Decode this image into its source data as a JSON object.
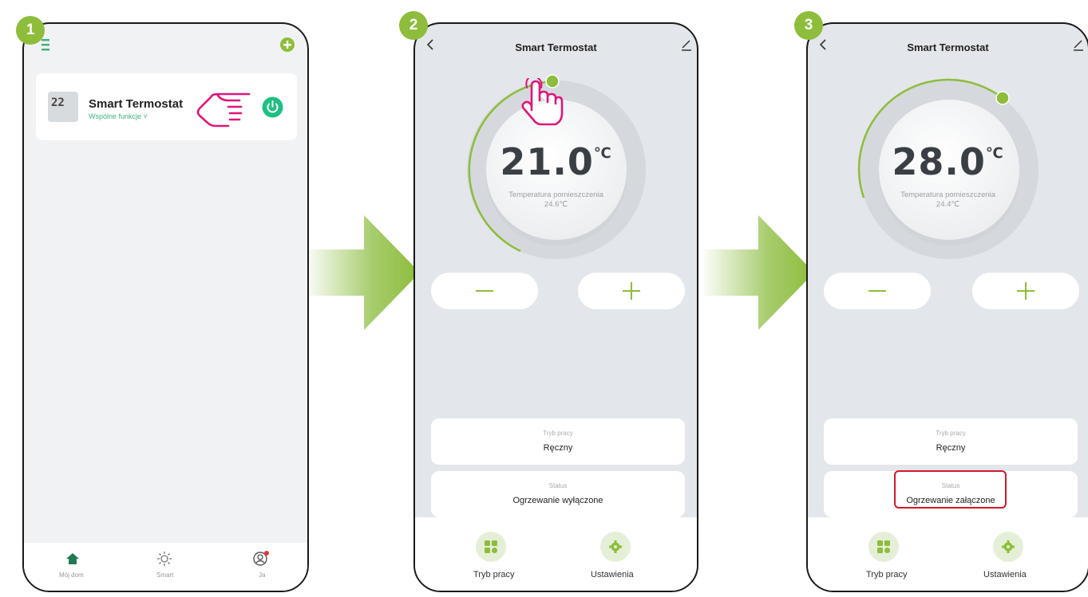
{
  "steps": [
    "1",
    "2",
    "3"
  ],
  "screen1": {
    "device_name": "Smart Termostat",
    "device_sub": "Wspólne funkcje ˅",
    "thumb_display": "22",
    "tabs": [
      "Mój dom",
      "Smart",
      "Ja"
    ]
  },
  "screen2": {
    "title": "Smart Termostat",
    "set_temp": "21.0",
    "unit": "℃",
    "room_label": "Temperatura pomieszczenia",
    "room_temp": "24.6℃",
    "mode_label": "Tryb pracy",
    "mode_value": "Ręczny",
    "status_label": "Status",
    "status_value": "Ogrzewanie wyłączone",
    "nav": [
      "Tryb pracy",
      "Ustawienia"
    ]
  },
  "screen3": {
    "title": "Smart Termostat",
    "set_temp": "28.0",
    "unit": "℃",
    "room_label": "Temperatura pomieszczenia",
    "room_temp": "24.4℃",
    "mode_label": "Tryb pracy",
    "mode_value": "Ręczny",
    "status_label": "Status",
    "status_value": "Ogrzewanie załączone",
    "nav": [
      "Tryb pracy",
      "Ustawienia"
    ]
  },
  "colors": {
    "accent_green": "#8dbd3a",
    "app_green": "#3fb07e",
    "pointer_pink": "#e0157a",
    "highlight_red": "#d0192c"
  }
}
